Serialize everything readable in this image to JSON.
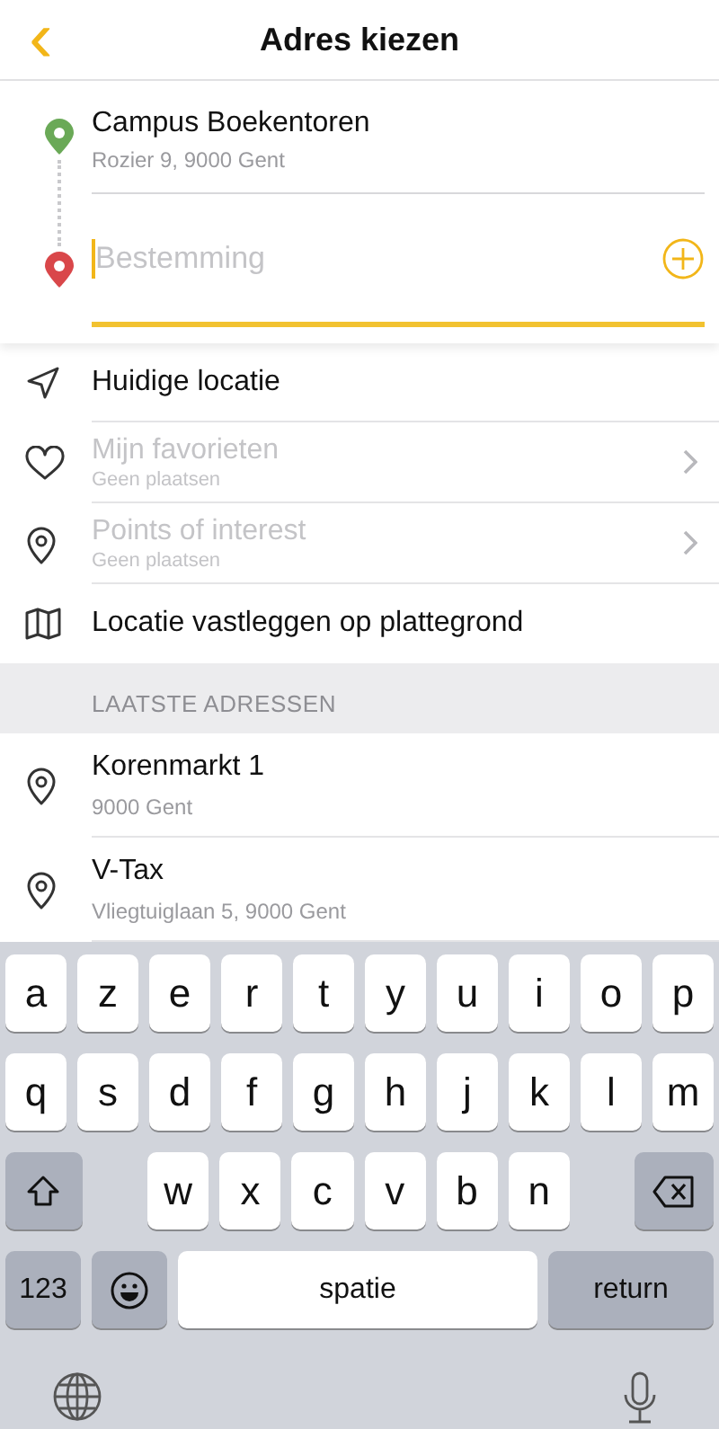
{
  "header": {
    "back": "‹",
    "title": "Adres kiezen"
  },
  "route": {
    "origin": {
      "title": "Campus Boekentoren",
      "subtitle": "Rozier 9, 9000 Gent"
    },
    "destination": {
      "placeholder": "Bestemming"
    }
  },
  "options": [
    {
      "kind": "navigation",
      "label": "Huidige locatie",
      "disabled": false
    },
    {
      "kind": "heart",
      "label": "Mijn favorieten",
      "subtitle": "Geen plaatsen",
      "disabled": true
    },
    {
      "kind": "pin",
      "label": "Points of interest",
      "subtitle": "Geen plaatsen",
      "disabled": true
    },
    {
      "kind": "map",
      "label": "Locatie vastleggen op plattegrond",
      "disabled": false
    }
  ],
  "recent": {
    "heading": "LAATSTE ADRESSEN",
    "items": [
      {
        "title": "Korenmarkt 1",
        "subtitle": "9000 Gent"
      },
      {
        "title": "V-Tax",
        "subtitle": "Vliegtuiglaan 5, 9000 Gent"
      }
    ]
  },
  "keyboard": {
    "rows": [
      [
        {
          "kind": "letter",
          "label": "a"
        },
        {
          "kind": "letter",
          "label": "z"
        },
        {
          "kind": "letter",
          "label": "e"
        },
        {
          "kind": "letter",
          "label": "r"
        },
        {
          "kind": "letter",
          "label": "t"
        },
        {
          "kind": "letter",
          "label": "y"
        },
        {
          "kind": "letter",
          "label": "u"
        },
        {
          "kind": "letter",
          "label": "i"
        },
        {
          "kind": "letter",
          "label": "o"
        },
        {
          "kind": "letter",
          "label": "p"
        }
      ],
      [
        {
          "kind": "letter",
          "label": "q"
        },
        {
          "kind": "letter",
          "label": "s"
        },
        {
          "kind": "letter",
          "label": "d"
        },
        {
          "kind": "letter",
          "label": "f"
        },
        {
          "kind": "letter",
          "label": "g"
        },
        {
          "kind": "letter",
          "label": "h"
        },
        {
          "kind": "letter",
          "label": "j"
        },
        {
          "kind": "letter",
          "label": "k"
        },
        {
          "kind": "letter",
          "label": "l"
        },
        {
          "kind": "letter",
          "label": "m"
        }
      ],
      [
        {
          "kind": "shift"
        },
        "",
        {
          "kind": "letter",
          "label": "w"
        },
        {
          "kind": "letter",
          "label": "x"
        },
        {
          "kind": "letter",
          "label": "c"
        },
        {
          "kind": "letter",
          "label": "v"
        },
        {
          "kind": "letter",
          "label": "b"
        },
        {
          "kind": "letter",
          "label": "n"
        },
        "",
        {
          "kind": "backspace"
        }
      ]
    ],
    "bottom_keys": [
      {
        "kind": "numbers",
        "label": "123"
      },
      {
        "kind": "emoji"
      },
      {
        "kind": "space",
        "label": "spatie"
      },
      {
        "kind": "return",
        "label": "return"
      }
    ]
  }
}
